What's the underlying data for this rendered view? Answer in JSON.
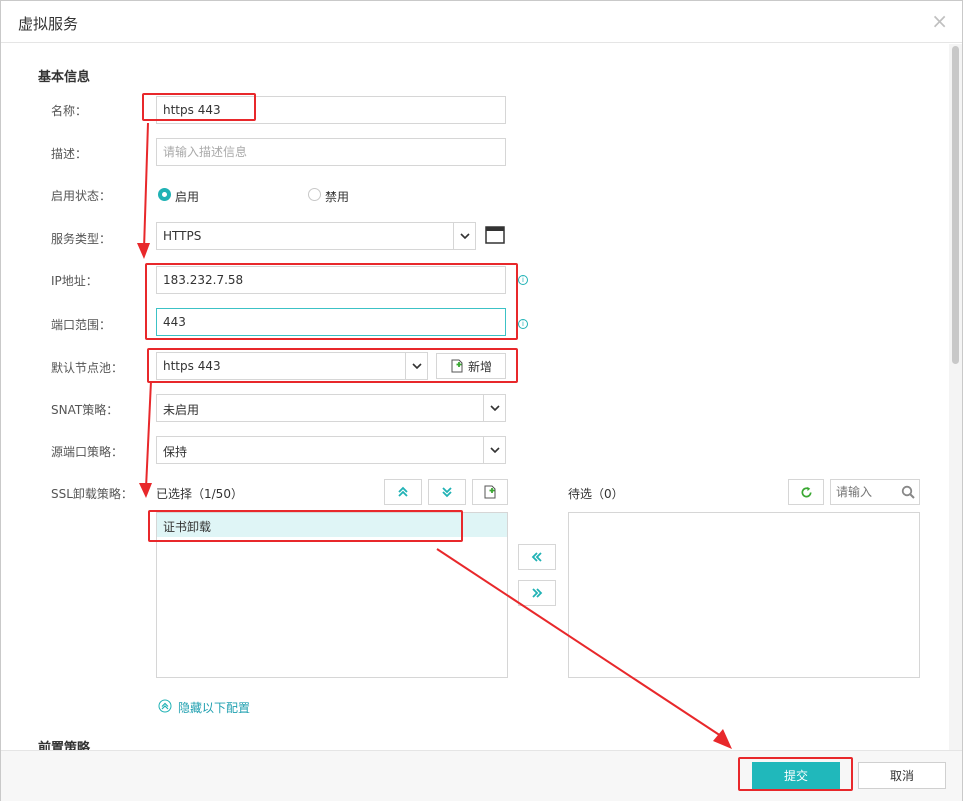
{
  "dialog": {
    "title": "虚拟服务",
    "close_glyph": "×"
  },
  "basic": {
    "section_title": "基本信息",
    "name_label": "名称：",
    "name_value": "https 443",
    "desc_label": "描述：",
    "desc_placeholder": "请输入描述信息",
    "status_label": "启用状态：",
    "status_on": "启用",
    "status_off": "禁用",
    "service_type_label": "服务类型：",
    "service_type_value": "HTTPS",
    "ip_label": "IP地址：",
    "ip_value": "183.232.7.58",
    "port_label": "端口范围：",
    "port_value": "443",
    "pool_label": "默认节点池：",
    "pool_value": "https 443",
    "pool_add": "新增",
    "snat_label": "SNAT策略：",
    "snat_value": "未启用",
    "src_port_label": "源端口策略：",
    "src_port_value": "保持",
    "ssl_label": "SSL卸载策略：",
    "selected_header": "已选择（1/50）",
    "selected_items": [
      "证书卸载"
    ],
    "pending_header": "待选（0）",
    "search_placeholder": "请输入",
    "hide_config": "隐藏以下配置"
  },
  "front": {
    "section_title": "前置策略"
  },
  "footer": {
    "submit": "提交",
    "cancel": "取消"
  },
  "colors": {
    "accent": "#20b8bb",
    "annotation": "#e8282b"
  }
}
